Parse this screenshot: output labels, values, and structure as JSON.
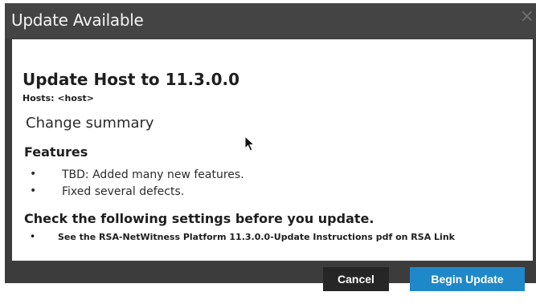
{
  "dialog": {
    "title": "Update Available",
    "close_glyph": "×",
    "heading": "Update Host to 11.3.0.0",
    "hosts_label": "Hosts: <host>",
    "change_summary": "Change summary",
    "features_label": "Features",
    "features": [
      "TBD: Added many new features.",
      "Fixed several defects."
    ],
    "check_label": "Check the following settings before you update.",
    "checks": [
      "See the RSA-NetWitness Platform 11.3.0.0-Update Instructions pdf on RSA Link"
    ],
    "bullet_glyph": "•"
  },
  "buttons": {
    "cancel": "Cancel",
    "begin_update": "Begin Update"
  },
  "icons": {
    "close": "close-icon",
    "cursor": "mouse-pointer-icon"
  },
  "colors": {
    "titlebar": "#444444",
    "footer": "#3c3c3c",
    "cancel_button": "#262626",
    "primary_button": "#1f88c9"
  }
}
